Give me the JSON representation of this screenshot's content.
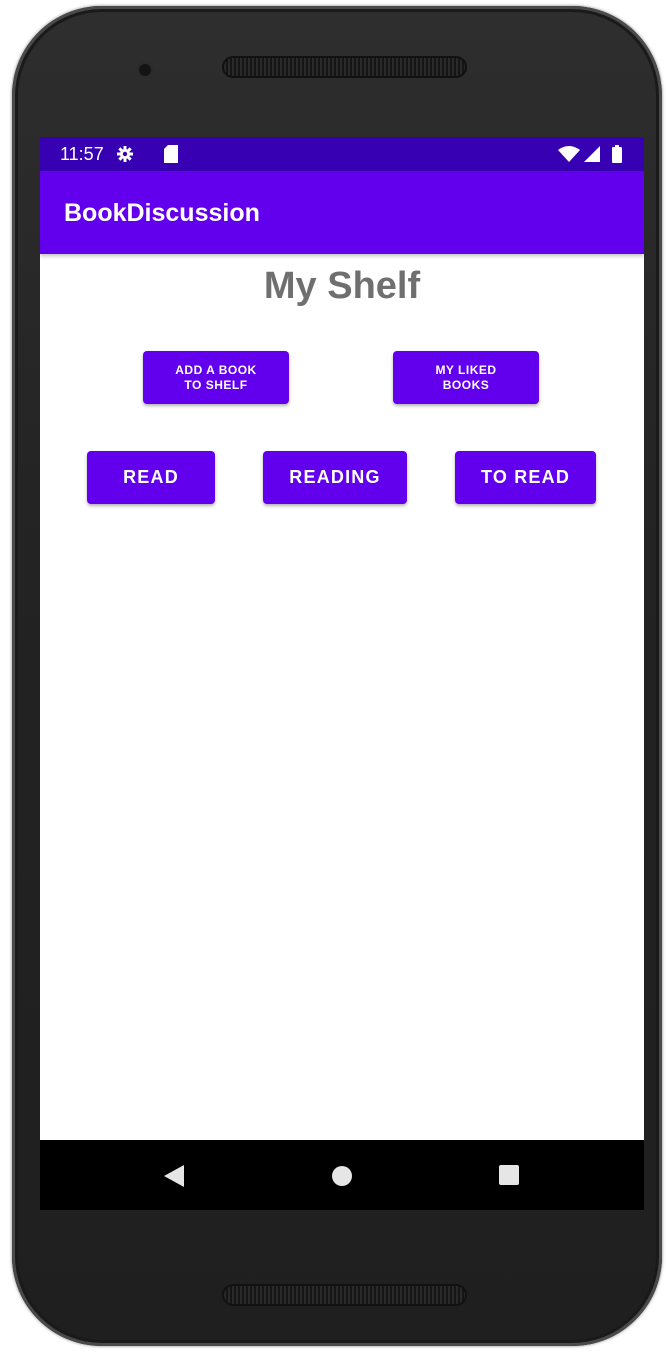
{
  "status_bar": {
    "time": "11:57",
    "icons": [
      "settings-gear-icon",
      "sd-card-icon",
      "wifi-icon",
      "signal-icon",
      "battery-icon"
    ],
    "background": "#3700b3"
  },
  "app_bar": {
    "title": "BookDiscussion",
    "background": "#6200ee"
  },
  "main": {
    "title": "My Shelf",
    "title_color": "#6f6f6f",
    "buttons_row1": [
      {
        "label": "ADD A BOOK\nTO SHELF"
      },
      {
        "label": "MY LIKED\nBOOKS"
      }
    ],
    "buttons_row2": [
      {
        "label": "READ"
      },
      {
        "label": "READING"
      },
      {
        "label": "TO READ"
      }
    ],
    "accent": "#6200ee"
  },
  "nav_bar": {
    "icons": [
      "back-icon",
      "home-icon",
      "recents-icon"
    ]
  }
}
